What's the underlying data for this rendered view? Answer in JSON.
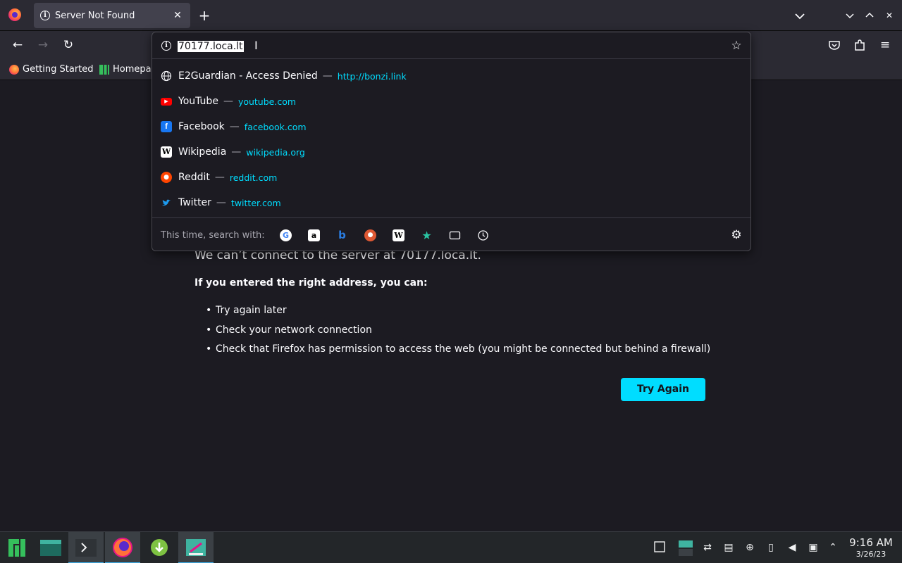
{
  "colors": {
    "accent": "#00ddff",
    "toolbar": "#2b2a33",
    "page_bg": "#1c1b22",
    "taskbar": "#232629"
  },
  "tab": {
    "title": "Server Not Found",
    "icon": "info-icon",
    "close": "✕"
  },
  "toolbar": {
    "new_tab": "+",
    "back": "←",
    "forward": "→",
    "reload": "↻",
    "star": "☆",
    "menu": "≡"
  },
  "window": {
    "list_all_tabs": "⌄",
    "minimize": "⌄",
    "maximize": "⌃",
    "close": "✕"
  },
  "bookmarks": [
    {
      "label": "Getting Started",
      "icon": "firefox-icon"
    },
    {
      "label": "Homepa",
      "icon": "manjaro-icon"
    }
  ],
  "urlbar": {
    "value": "70177.loca.lt",
    "results": [
      {
        "title": "E2Guardian - Access Denied",
        "url": "http://bonzi.link",
        "icon": "globe-icon"
      },
      {
        "title": "YouTube",
        "url": "youtube.com",
        "icon": "youtube-icon"
      },
      {
        "title": "Facebook",
        "url": "facebook.com",
        "icon": "facebook-icon"
      },
      {
        "title": "Wikipedia",
        "url": "wikipedia.org",
        "icon": "wikipedia-icon"
      },
      {
        "title": "Reddit",
        "url": "reddit.com",
        "icon": "reddit-icon"
      },
      {
        "title": "Twitter",
        "url": "twitter.com",
        "icon": "twitter-icon"
      }
    ],
    "separator": "—",
    "search_with_label": "This time, search with:",
    "engines": [
      "google-icon",
      "amazon-icon",
      "bing-icon",
      "duckduckgo-icon",
      "wikipedia-icon",
      "bookmarks-icon",
      "tabs-icon",
      "history-icon"
    ]
  },
  "error": {
    "lead": "We can’t connect to the server at 70177.loca.lt.",
    "subheading": "If you entered the right address, you can:",
    "items": [
      "Try again later",
      "Check your network connection",
      "Check that Firefox has permission to access the web (you might be connected but behind a firewall)"
    ],
    "button": "Try Again"
  },
  "taskbar": {
    "tasks": [
      "manjaro-menu-icon",
      "file-manager-icon",
      "terminal-icon",
      "firefox-icon",
      "download-icon",
      "app-icon"
    ],
    "time": "9:16 AM",
    "date": "3/26/23"
  }
}
